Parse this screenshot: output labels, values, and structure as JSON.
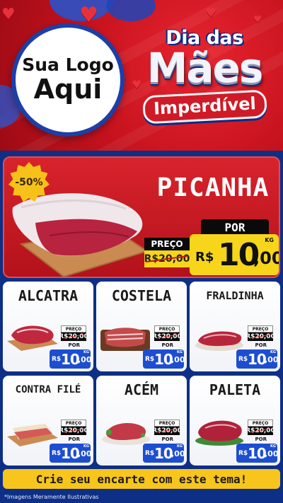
{
  "header": {
    "logo_line1": "Sua Logo",
    "logo_line2": "Aqui",
    "title_top": "Dia das",
    "title_main": "Mães",
    "title_badge": "Imperdível"
  },
  "featured": {
    "discount": "-50%",
    "name": "PICANHA",
    "por_label": "POR",
    "preco_label": "PREÇO",
    "old_price": "R$20,00",
    "currency": "R$",
    "price_int": "10",
    "price_cents": ",00",
    "unit": "KG"
  },
  "products": [
    {
      "name": "ALCATRA",
      "preco_label": "PREÇO",
      "old_price": "R$20,00",
      "por_label": "POR",
      "currency": "R$",
      "price_int": "10",
      "price_cents": ",00",
      "unit": "KG"
    },
    {
      "name": "COSTELA",
      "preco_label": "PREÇO",
      "old_price": "R$20,00",
      "por_label": "POR",
      "currency": "R$",
      "price_int": "10",
      "price_cents": ",00",
      "unit": "KG"
    },
    {
      "name": "FRALDINHA",
      "preco_label": "PREÇO",
      "old_price": "R$20,00",
      "por_label": "POR",
      "currency": "R$",
      "price_int": "10",
      "price_cents": ",00",
      "unit": "KG"
    },
    {
      "name": "CONTRA FILÉ",
      "preco_label": "PREÇO",
      "old_price": "R$20,00",
      "por_label": "POR",
      "currency": "R$",
      "price_int": "10",
      "price_cents": ",00",
      "unit": "KG"
    },
    {
      "name": "ACÉM",
      "preco_label": "PREÇO",
      "old_price": "R$20,00",
      "por_label": "POR",
      "currency": "R$",
      "price_int": "10",
      "price_cents": ",00",
      "unit": "KG"
    },
    {
      "name": "PALETA",
      "preco_label": "PREÇO",
      "old_price": "R$20,00",
      "por_label": "POR",
      "currency": "R$",
      "price_int": "10",
      "price_cents": ",00",
      "unit": "KG"
    }
  ],
  "cta": "Crie seu encarte com este tema!",
  "disclaimer": "*Imagens Meramente Ilustrativas",
  "colors": {
    "header_red": "#c4121d",
    "background_blue": "#0d2f86",
    "price_yellow": "#f7d51b",
    "price_blue": "#1d4ed1"
  }
}
